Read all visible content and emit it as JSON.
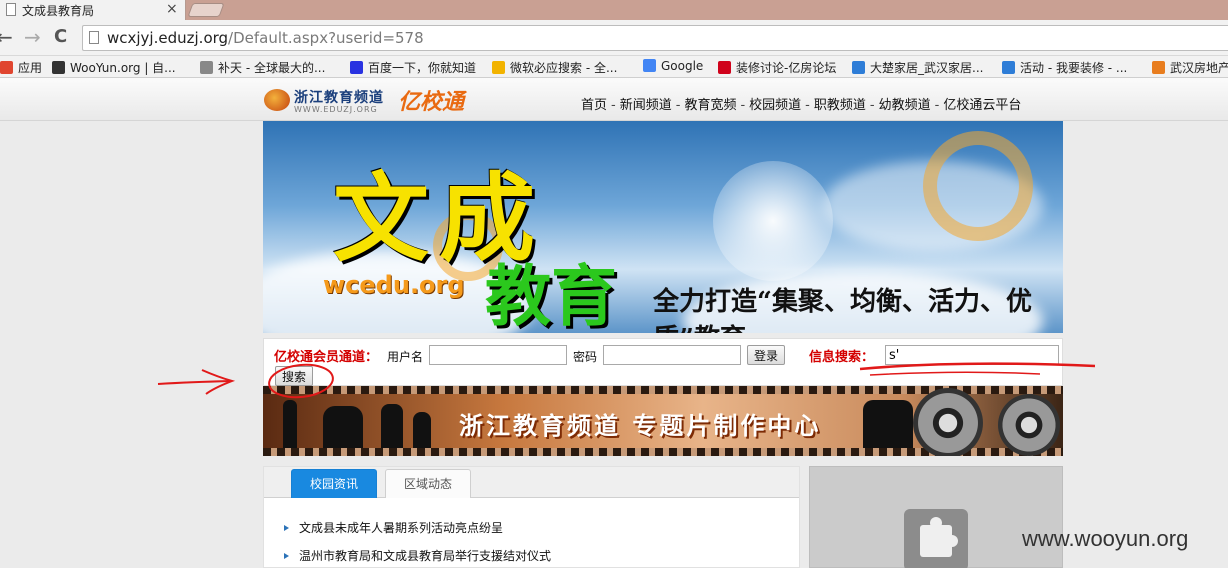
{
  "browser": {
    "tab_title": "文成县教育局",
    "tab_close": "×",
    "url_host": "wcxjyj.eduzj.org",
    "url_path": "/Default.aspx?userid=578",
    "nav_back": "←",
    "nav_forward": "→",
    "nav_reload": "C"
  },
  "bookmarks": [
    {
      "label": "应用",
      "icon": "apps-icon",
      "color": "#e0452f"
    },
    {
      "label": "WooYun.org | 自...",
      "icon": "wooyun-icon",
      "color": "#333333"
    },
    {
      "label": "补天 - 全球最大的...",
      "icon": "butian-icon",
      "color": "#888888"
    },
    {
      "label": "百度一下，你就知道",
      "icon": "baidu-icon",
      "color": "#2932e1"
    },
    {
      "label": "微软必应搜索 - 全...",
      "icon": "bing-icon",
      "color": "#f2b300"
    },
    {
      "label": "Google",
      "icon": "google-icon",
      "color": "#4285f4"
    },
    {
      "label": "装修讨论-亿房论坛",
      "icon": "fang-icon",
      "color": "#d0021b"
    },
    {
      "label": "大楚家居_武汉家居...",
      "icon": "dachu-icon",
      "color": "#2e7dd7"
    },
    {
      "label": "活动 - 我要装修 - ...",
      "icon": "activity-icon",
      "color": "#2e7dd7"
    },
    {
      "label": "武汉房地产",
      "icon": "wuhan-icon",
      "color": "#e87d1e"
    }
  ],
  "site": {
    "logo_text": "浙江教育频道",
    "logo_sub": "WWW.EDUZJ.ORG",
    "brand": "亿校通",
    "nav": [
      "首页",
      "新闻频道",
      "教育宽频",
      "校园频道",
      "职教频道",
      "幼教频道",
      "亿校通云平台"
    ],
    "nav_sep": "-"
  },
  "banner": {
    "title1": "文成",
    "title2": "教育",
    "site": "wcedu.org",
    "slogan": "全力打造“集聚、均衡、活力、优质”教育"
  },
  "login": {
    "channel_label": "亿校通会员通道：",
    "username_label": "用户名",
    "username_value": "",
    "password_label": "密码",
    "password_value": "",
    "login_button": "登录",
    "search_label": "信息搜索：",
    "search_value": "s'",
    "search_button": "搜索"
  },
  "film_banner": {
    "text": "浙江教育频道  专题片制作中心"
  },
  "news": {
    "tabs": [
      {
        "label": "校园资讯",
        "active": true
      },
      {
        "label": "区域动态",
        "active": false
      }
    ],
    "items": [
      "文成县未成年人暑期系列活动亮点纷呈",
      "温州市教育局和文成县教育局举行支援结对仪式"
    ]
  },
  "watermark": "www.wooyun.org",
  "colors": {
    "annotation_red": "#e11919",
    "label_red": "#d40000",
    "tab_blue": "#1989e0"
  }
}
